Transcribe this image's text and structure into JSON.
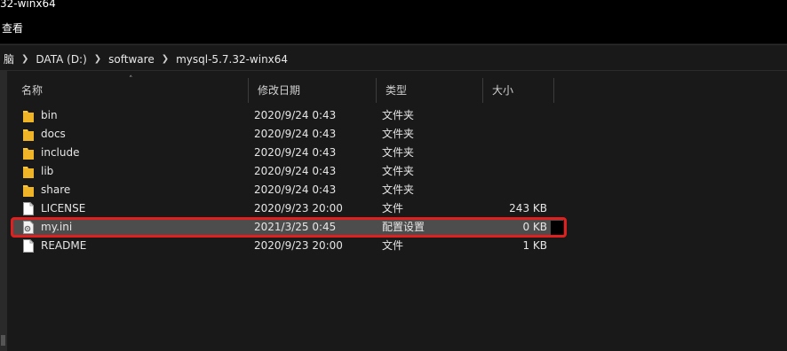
{
  "window": {
    "title": "32-winx64"
  },
  "menu": {
    "view_label": "查看"
  },
  "breadcrumb": {
    "items": [
      "脑",
      "DATA (D:)",
      "software",
      "mysql-5.7.32-winx64"
    ]
  },
  "columns": {
    "name": "名称",
    "date": "修改日期",
    "type": "类型",
    "size": "大小"
  },
  "files": [
    {
      "name": "bin",
      "date": "2020/9/24 0:43",
      "type": "文件夹",
      "size": "",
      "icon": "folder-icon"
    },
    {
      "name": "docs",
      "date": "2020/9/24 0:43",
      "type": "文件夹",
      "size": "",
      "icon": "folder-icon"
    },
    {
      "name": "include",
      "date": "2020/9/24 0:43",
      "type": "文件夹",
      "size": "",
      "icon": "folder-icon"
    },
    {
      "name": "lib",
      "date": "2020/9/24 0:43",
      "type": "文件夹",
      "size": "",
      "icon": "folder-icon"
    },
    {
      "name": "share",
      "date": "2020/9/24 0:43",
      "type": "文件夹",
      "size": "",
      "icon": "folder-icon"
    },
    {
      "name": "LICENSE",
      "date": "2020/9/23 20:00",
      "type": "文件",
      "size": "243 KB",
      "icon": "file-icon"
    },
    {
      "name": "my.ini",
      "date": "2021/3/25 0:45",
      "type": "配置设置",
      "size": "0 KB",
      "icon": "settings-file-icon"
    },
    {
      "name": "README",
      "date": "2020/9/23 20:00",
      "type": "文件",
      "size": "1 KB",
      "icon": "file-icon"
    }
  ],
  "colors": {
    "highlight": "#e0201f",
    "folder": "#f7c641",
    "selected_row": "#4d4d4d"
  }
}
